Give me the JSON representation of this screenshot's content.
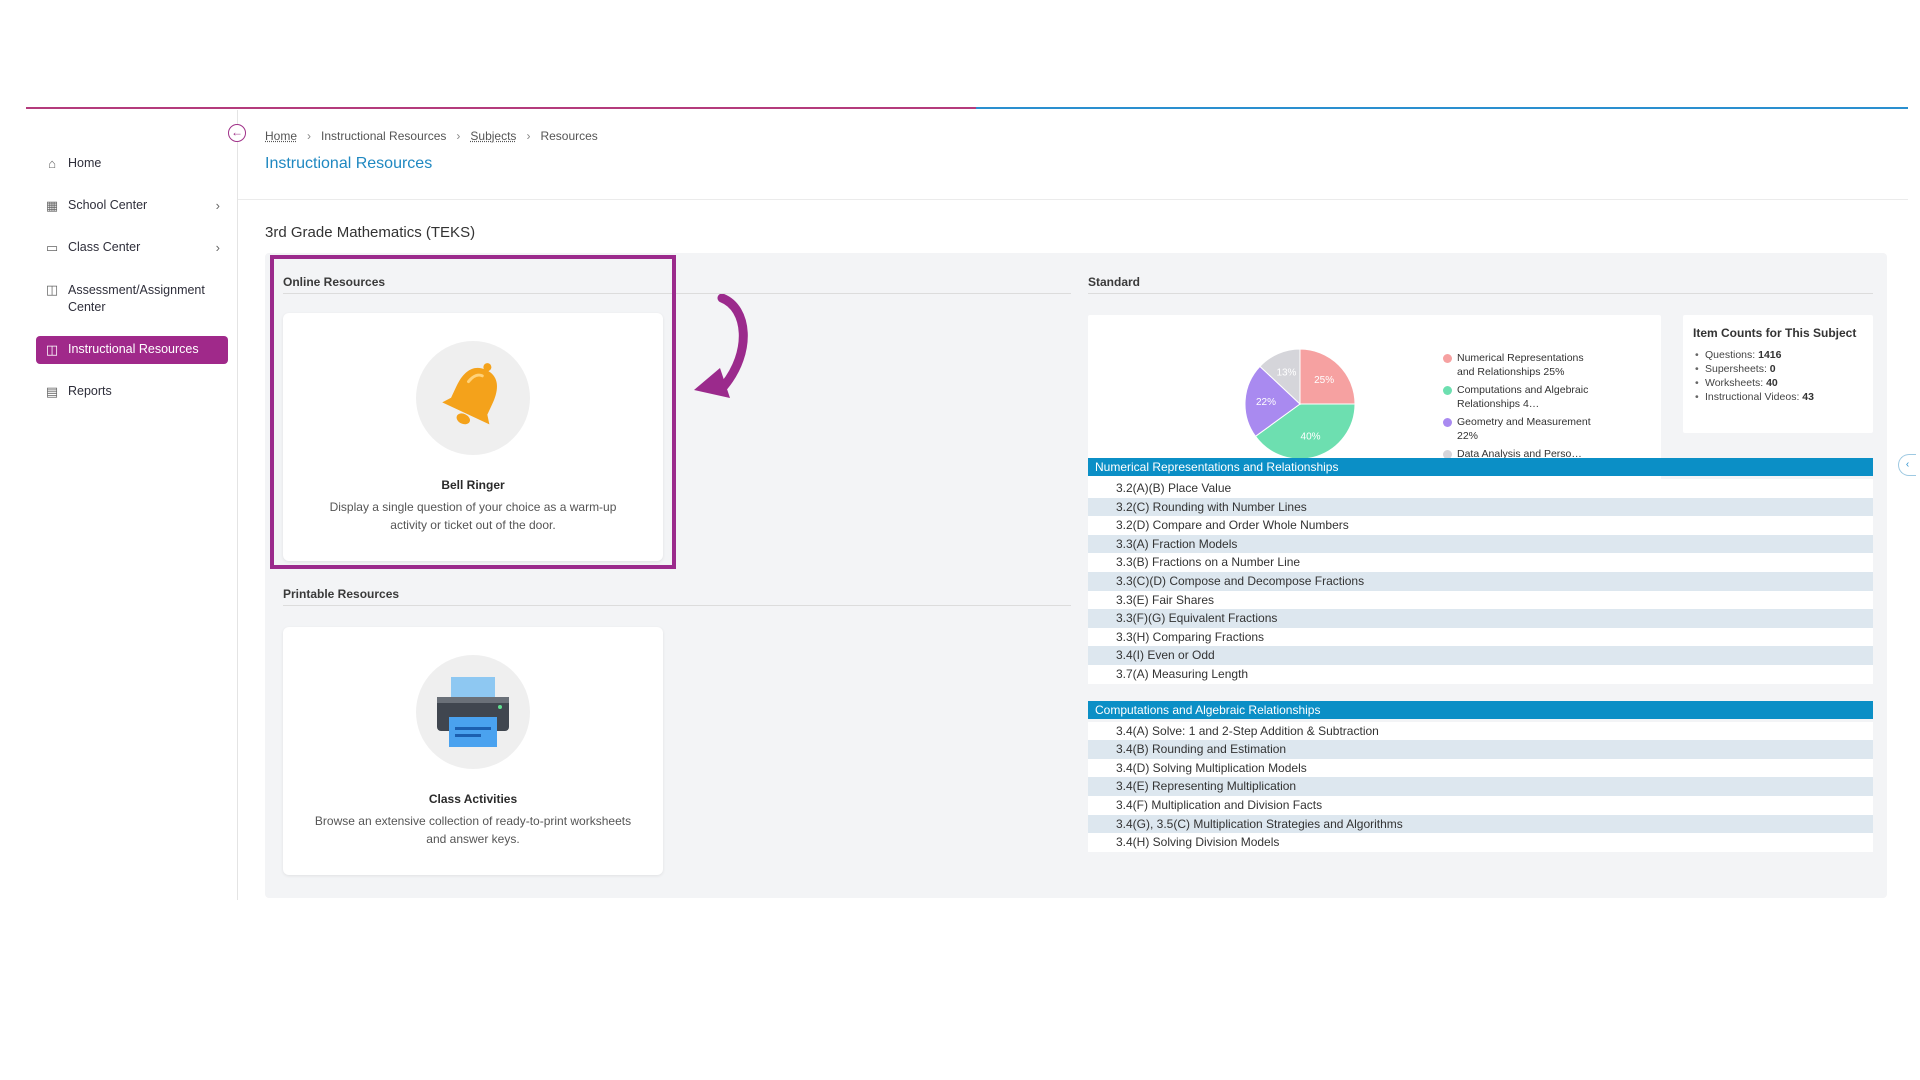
{
  "sidebar": {
    "collapse_icon": "arrow-left-circle-icon",
    "items": [
      {
        "label": "Home",
        "icon": "home-icon"
      },
      {
        "label": "School Center",
        "icon": "building-icon",
        "chevron": true
      },
      {
        "label": "Class Center",
        "icon": "monitor-icon",
        "chevron": true
      },
      {
        "label": "Assessment/Assignment Center",
        "icon": "book-icon"
      },
      {
        "label": "Instructional Resources",
        "icon": "open-book-icon",
        "active": true
      },
      {
        "label": "Reports",
        "icon": "report-icon"
      }
    ]
  },
  "breadcrumb": [
    "Home",
    "Instructional Resources",
    "Subjects",
    "Resources"
  ],
  "page_title": "Instructional Resources",
  "subject_title": "3rd Grade Mathematics (TEKS)",
  "online": {
    "label": "Online Resources",
    "card": {
      "name": "Bell Ringer",
      "desc": "Display a single question of your choice as a warm-up activity or ticket out of the door.",
      "icon": "bell-icon"
    }
  },
  "printable": {
    "label": "Printable Resources",
    "card": {
      "name": "Class Activities",
      "desc": "Browse an extensive collection of ready-to-print worksheets and answer keys.",
      "icon": "printer-icon"
    }
  },
  "standard": {
    "label": "Standard",
    "counts_title": "Item Counts for This Subject",
    "counts": [
      {
        "label": "Questions:",
        "value": "1416"
      },
      {
        "label": "Supersheets:",
        "value": "0"
      },
      {
        "label": "Worksheets:",
        "value": "40"
      },
      {
        "label": "Instructional Videos:",
        "value": "43"
      }
    ],
    "groups": [
      {
        "title": "Numerical Representations and Relationships",
        "rows": [
          "3.2(A)(B) Place Value",
          "3.2(C) Rounding with Number Lines",
          "3.2(D) Compare and Order Whole Numbers",
          "3.3(A) Fraction Models",
          "3.3(B) Fractions on a Number Line",
          "3.3(C)(D) Compose and Decompose Fractions",
          "3.3(E) Fair Shares",
          "3.3(F)(G) Equivalent Fractions",
          "3.3(H) Comparing Fractions",
          "3.4(I) Even or Odd",
          "3.7(A) Measuring Length"
        ]
      },
      {
        "title": "Computations and Algebraic Relationships",
        "rows": [
          "3.4(A) Solve: 1 and 2-Step Addition & Subtraction",
          "3.4(B) Rounding and Estimation",
          "3.4(D) Solving Multiplication Models",
          "3.4(E) Representing Multiplication",
          "3.4(F) Multiplication and Division Facts",
          "3.4(G), 3.5(C) Multiplication Strategies and Algorithms",
          "3.4(H) Solving Division Models"
        ]
      }
    ]
  },
  "chart_data": {
    "type": "pie",
    "title": "",
    "legend_placement": "right",
    "slices": [
      {
        "name": "Numerical Representations and Relationships",
        "legend_text": "Numerical Representations and Relationships 25%",
        "value": 25,
        "label": "25%",
        "color": "#f6a1a1"
      },
      {
        "name": "Computations and Algebraic Relationships",
        "legend_text": "Computations and Algebraic Relationships 4…",
        "value": 40,
        "label": "40%",
        "color": "#6ddfb0"
      },
      {
        "name": "Geometry and Measurement",
        "legend_text": "Geometry and Measurement 22%",
        "value": 22,
        "label": "22%",
        "color": "#a98af0"
      },
      {
        "name": "Data Analysis and Perso…",
        "legend_text": "Data Analysis and Perso…",
        "value": 13,
        "label": "13%",
        "color": "#d5d5da"
      }
    ]
  },
  "colors": {
    "brand": "#a0298a",
    "link": "#1f88c1",
    "standard_header": "#0b8fc6"
  }
}
